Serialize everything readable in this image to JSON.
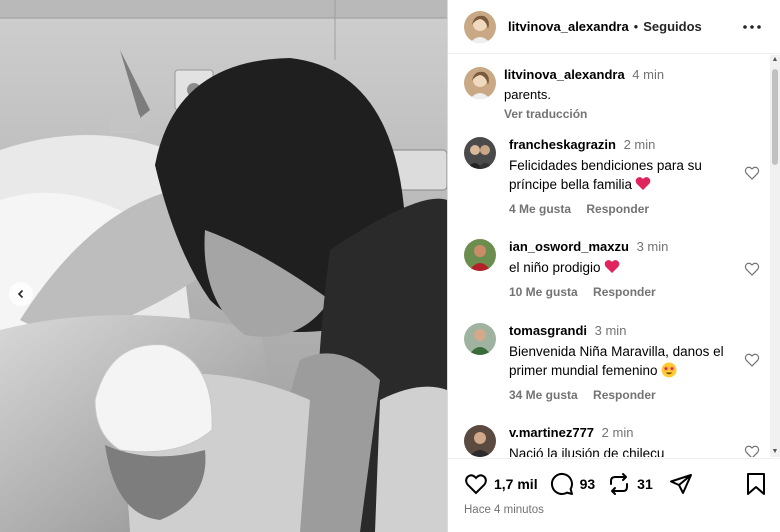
{
  "post": {
    "username": "litvinova_alexandra",
    "separator": "•",
    "follow_status": "Seguidos",
    "posted_ago": "Hace 4 minutos"
  },
  "caption": {
    "username": "litvinova_alexandra",
    "time": "4 min",
    "text": "parents.",
    "translate": "Ver traducción"
  },
  "comments": [
    {
      "username": "francheskagrazin",
      "time": "2 min",
      "text": "Felicidades bendiciones para su príncipe bella familia",
      "emoji": "red-heart",
      "likes": "4 Me gusta",
      "reply": "Responder"
    },
    {
      "username": "ian_osword_maxzu",
      "time": "3 min",
      "text": "el niño prodigio",
      "emoji": "red-heart",
      "likes": "10 Me gusta",
      "reply": "Responder"
    },
    {
      "username": "tomasgrandi",
      "time": "3 min",
      "text": "Bienvenida Niña Maravilla, danos el primer mundial femenino",
      "emoji": "star-struck",
      "likes": "34 Me gusta",
      "reply": "Responder"
    },
    {
      "username": "v.martinez777",
      "time": "2 min",
      "text": "Nació la ilusión de chilecu",
      "emoji": "",
      "likes": "",
      "reply": ""
    }
  ],
  "actions": {
    "likes": "1,7 mil",
    "comments": "93",
    "reposts": "31"
  },
  "icons": [
    "ellipsis-icon",
    "heart-icon",
    "comment-icon",
    "repost-icon",
    "share-icon",
    "bookmark-icon",
    "chevron-left-icon"
  ],
  "colors": {
    "heart_red": "#e0245e",
    "meta_gray": "#737373"
  }
}
